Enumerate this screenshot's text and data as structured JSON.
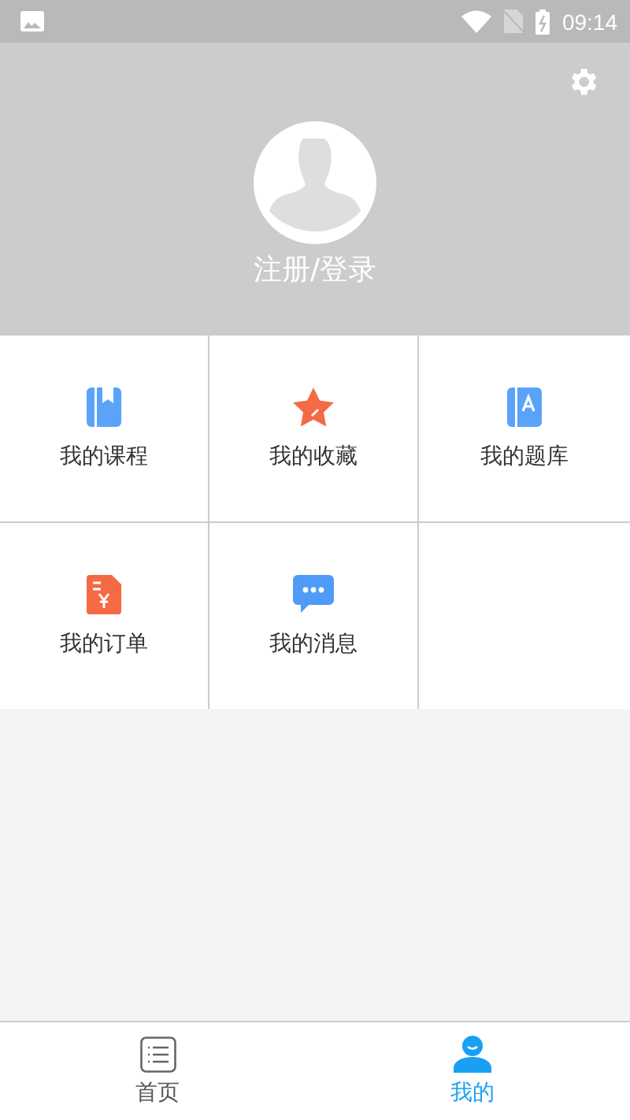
{
  "status_bar": {
    "time": "09:14"
  },
  "profile": {
    "login_label": "注册/登录"
  },
  "menu": [
    {
      "kind": "course",
      "label": "我的课程"
    },
    {
      "kind": "favorite",
      "label": "我的收藏"
    },
    {
      "kind": "question-bank",
      "label": "我的题库"
    },
    {
      "kind": "order",
      "label": "我的订单"
    },
    {
      "kind": "message",
      "label": "我的消息"
    }
  ],
  "tabs": [
    {
      "kind": "home",
      "label": "首页",
      "selected": false
    },
    {
      "kind": "me",
      "label": "我的",
      "selected": true
    }
  ]
}
